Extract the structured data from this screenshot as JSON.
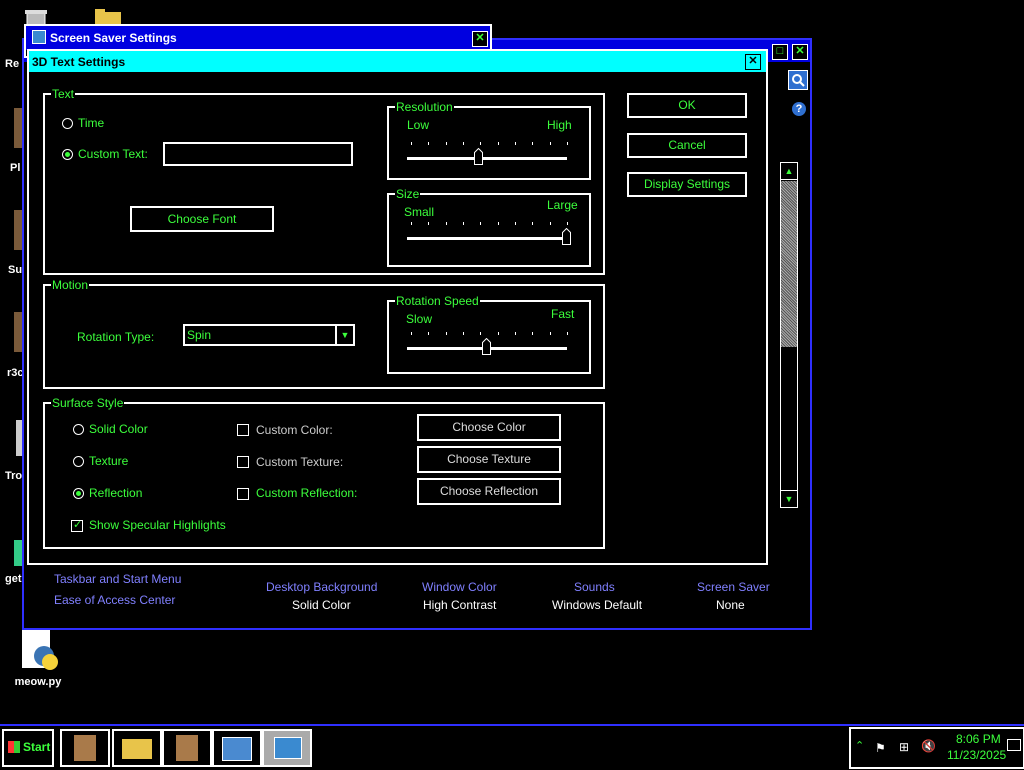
{
  "desktop": {
    "icons": [
      {
        "label": "Re"
      },
      {
        "label": "Pl"
      },
      {
        "label": "Su"
      },
      {
        "label": "r3c"
      },
      {
        "label": "Tro"
      },
      {
        "label": "get"
      },
      {
        "label": "meow.py"
      }
    ]
  },
  "bg_window": {
    "links": [
      "Taskbar and Start Menu",
      "Ease of Access Center"
    ],
    "personalize": [
      {
        "title": "Desktop Background",
        "value": "Solid Color"
      },
      {
        "title": "Window Color",
        "value": "High Contrast"
      },
      {
        "title": "Sounds",
        "value": "Windows Default"
      },
      {
        "title": "Screen Saver",
        "value": "None"
      }
    ]
  },
  "screensaver_window": {
    "title": "Screen Saver Settings"
  },
  "dialog": {
    "title": "3D Text Settings",
    "text_group": {
      "label": "Text",
      "time_label": "Time",
      "custom_text_label": "Custom Text:",
      "custom_text_value": "",
      "choose_font": "Choose Font",
      "selected": "custom"
    },
    "resolution": {
      "label": "Resolution",
      "low": "Low",
      "high": "High",
      "value": 0.45
    },
    "size": {
      "label": "Size",
      "small": "Small",
      "large": "Large",
      "value": 1.0
    },
    "motion_group": {
      "label": "Motion",
      "rotation_type_label": "Rotation Type:",
      "rotation_type_value": "Spin"
    },
    "rotation_speed": {
      "label": "Rotation Speed",
      "slow": "Slow",
      "fast": "Fast",
      "value": 0.5
    },
    "surface_group": {
      "label": "Surface Style",
      "solid_color": "Solid Color",
      "texture": "Texture",
      "reflection": "Reflection",
      "custom_color": "Custom Color:",
      "custom_texture": "Custom Texture:",
      "custom_reflection": "Custom Reflection:",
      "choose_color": "Choose Color",
      "choose_texture": "Choose Texture",
      "choose_reflection": "Choose Reflection",
      "specular": "Show Specular Highlights",
      "selected": "reflection",
      "specular_checked": true
    },
    "buttons": {
      "ok": "OK",
      "cancel": "Cancel",
      "display_settings": "Display Settings"
    }
  },
  "taskbar": {
    "start": "Start",
    "time": "8:06 PM",
    "date": "11/23/2025"
  }
}
